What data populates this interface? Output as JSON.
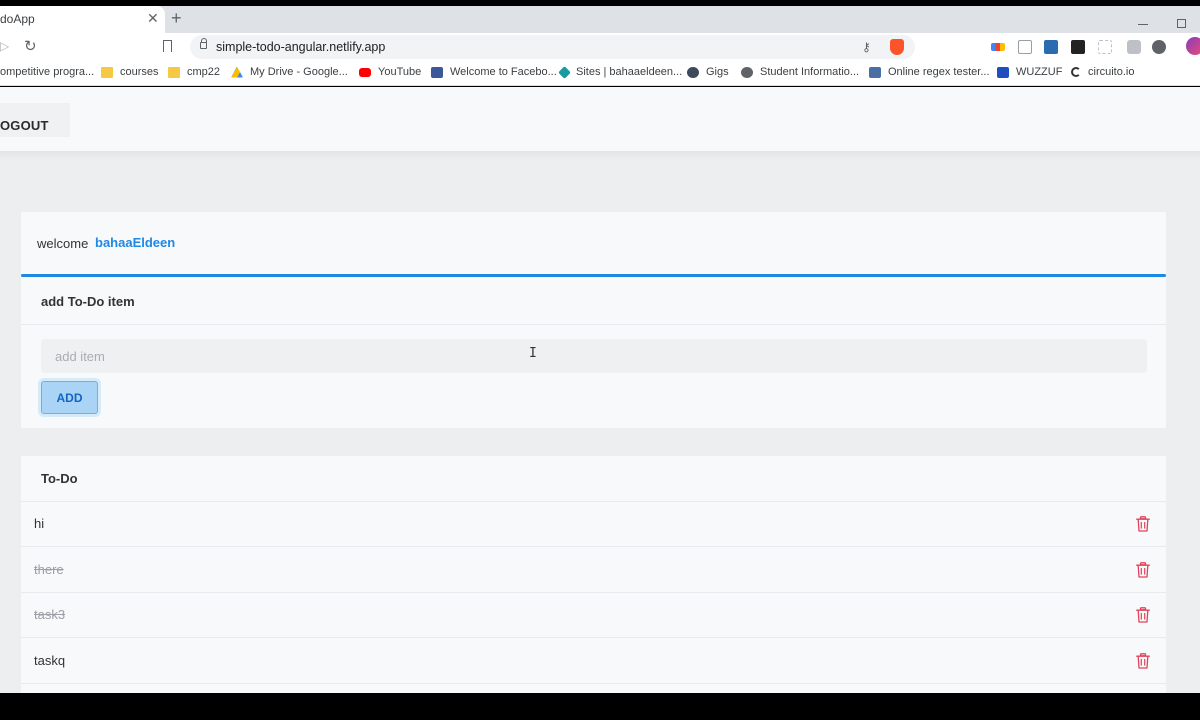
{
  "browser": {
    "tab_title": "doApp",
    "tab_close": "✕",
    "new_tab": "+",
    "url": "simple-todo-angular.netlify.app",
    "bookmarks": [
      {
        "label": "ompetitive progra...",
        "icon": "page"
      },
      {
        "label": "courses",
        "icon": "folder"
      },
      {
        "label": "cmp22",
        "icon": "folder"
      },
      {
        "label": "My Drive - Google...",
        "icon": "google-drive"
      },
      {
        "label": "YouTube",
        "icon": "youtube"
      },
      {
        "label": "Welcome to Facebo...",
        "icon": "facebook"
      },
      {
        "label": "Sites | bahaaeldeen...",
        "icon": "google-sites"
      },
      {
        "label": "Gigs",
        "icon": "gigs"
      },
      {
        "label": "Student Informatio...",
        "icon": "globe"
      },
      {
        "label": "Online regex tester...",
        "icon": "regex"
      },
      {
        "label": "WUZZUF",
        "icon": "wuzzuf"
      },
      {
        "label": "circuito.io",
        "icon": "circuito"
      }
    ]
  },
  "navbar": {
    "logout_label": "OGOUT"
  },
  "welcome": {
    "text": "welcome",
    "username": "bahaaEldeen"
  },
  "add_form": {
    "title": "add To-Do item",
    "placeholder": "add item",
    "button_label": "ADD"
  },
  "todo": {
    "title": "To-Do",
    "items": [
      {
        "text": "hi",
        "done": false
      },
      {
        "text": "there",
        "done": true
      },
      {
        "text": "task3",
        "done": true
      },
      {
        "text": "taskq",
        "done": false
      }
    ]
  },
  "colors": {
    "accent": "#1e88e5",
    "delete": "#e0435a"
  }
}
